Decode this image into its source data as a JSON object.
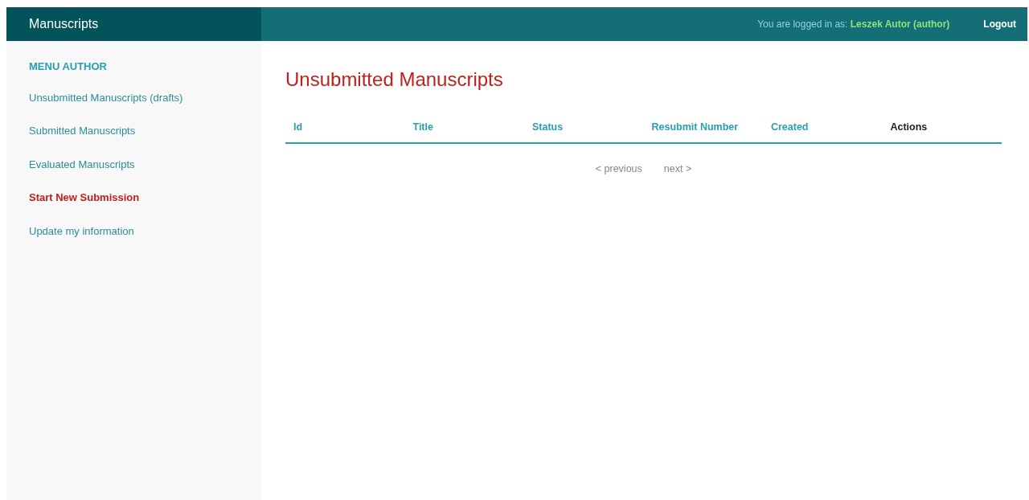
{
  "brand": "Manuscripts",
  "user": {
    "label": "You are logged in as:",
    "name": "Leszek Autor (author)"
  },
  "logout": "Logout",
  "sidebar": {
    "heading": "MENU AUTHOR",
    "items": [
      {
        "label": "Unsubmitted Manuscripts (drafts)",
        "kind": "link"
      },
      {
        "label": "Submitted Manuscripts",
        "kind": "link"
      },
      {
        "label": "Evaluated Manuscripts",
        "kind": "link"
      },
      {
        "label": "Start New Submission",
        "kind": "action"
      },
      {
        "label": "Update my information",
        "kind": "link"
      }
    ]
  },
  "title": "Unsubmitted Manuscripts",
  "table": {
    "columns": [
      {
        "label": "Id",
        "kind": "sortable"
      },
      {
        "label": "Title",
        "kind": "sortable"
      },
      {
        "label": "Status",
        "kind": "sortable"
      },
      {
        "label": "Resubmit Number",
        "kind": "sortable"
      },
      {
        "label": "Created",
        "kind": "sortable"
      },
      {
        "label": "Actions",
        "kind": "plain"
      }
    ]
  },
  "pagination": [
    {
      "label": "< previous",
      "disabled": true
    },
    {
      "label": "next >",
      "disabled": true
    }
  ]
}
